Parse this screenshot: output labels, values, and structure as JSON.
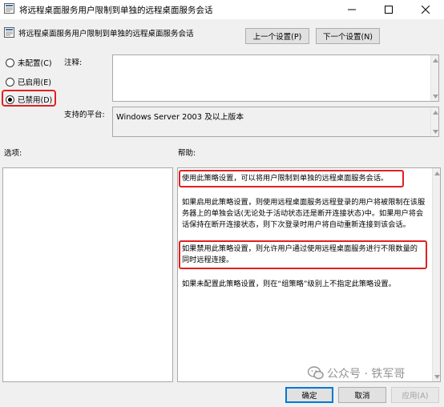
{
  "window": {
    "title": "将远程桌面服务用户限制到单独的远程桌面服务会话"
  },
  "header": {
    "title": "将远程桌面服务用户限制到单独的远程桌面服务会话",
    "prev_label": "上一个设置(P)",
    "next_label": "下一个设置(N)"
  },
  "options": {
    "not_configured": "未配置(C)",
    "enabled": "已启用(E)",
    "disabled": "已禁用(D)",
    "selected": "disabled"
  },
  "fields": {
    "comment_label": "注释:",
    "comment_value": "",
    "platform_label": "支持的平台:",
    "platform_value": "Windows Server 2003 及以上版本"
  },
  "sections": {
    "options_label": "选项:",
    "help_label": "帮助:"
  },
  "help": {
    "p1": "使用此策略设置，可以将用户限制到单独的远程桌面服务会话。",
    "p2": "如果启用此策略设置，则使用远程桌面服务远程登录的用户将被限制在该服务器上的单独会话(无论处于活动状态还是断开连接状态)中。如果用户将会话保持在断开连接状态，则下次登录时用户将自动重新连接到该会话。",
    "p3": "如果禁用此策略设置，则允许用户通过使用远程桌面服务进行不限数量的同时远程连接。",
    "p4": "如果未配置此策略设置，则在“组策略”级别上不指定此策略设置。"
  },
  "footer": {
    "ok_label": "确定",
    "cancel_label": "取消",
    "apply_label": "应用(A)"
  },
  "watermark": "公众号 · 铁军哥",
  "colors": {
    "highlight": "#e22020",
    "ok_border": "#0078d7"
  }
}
